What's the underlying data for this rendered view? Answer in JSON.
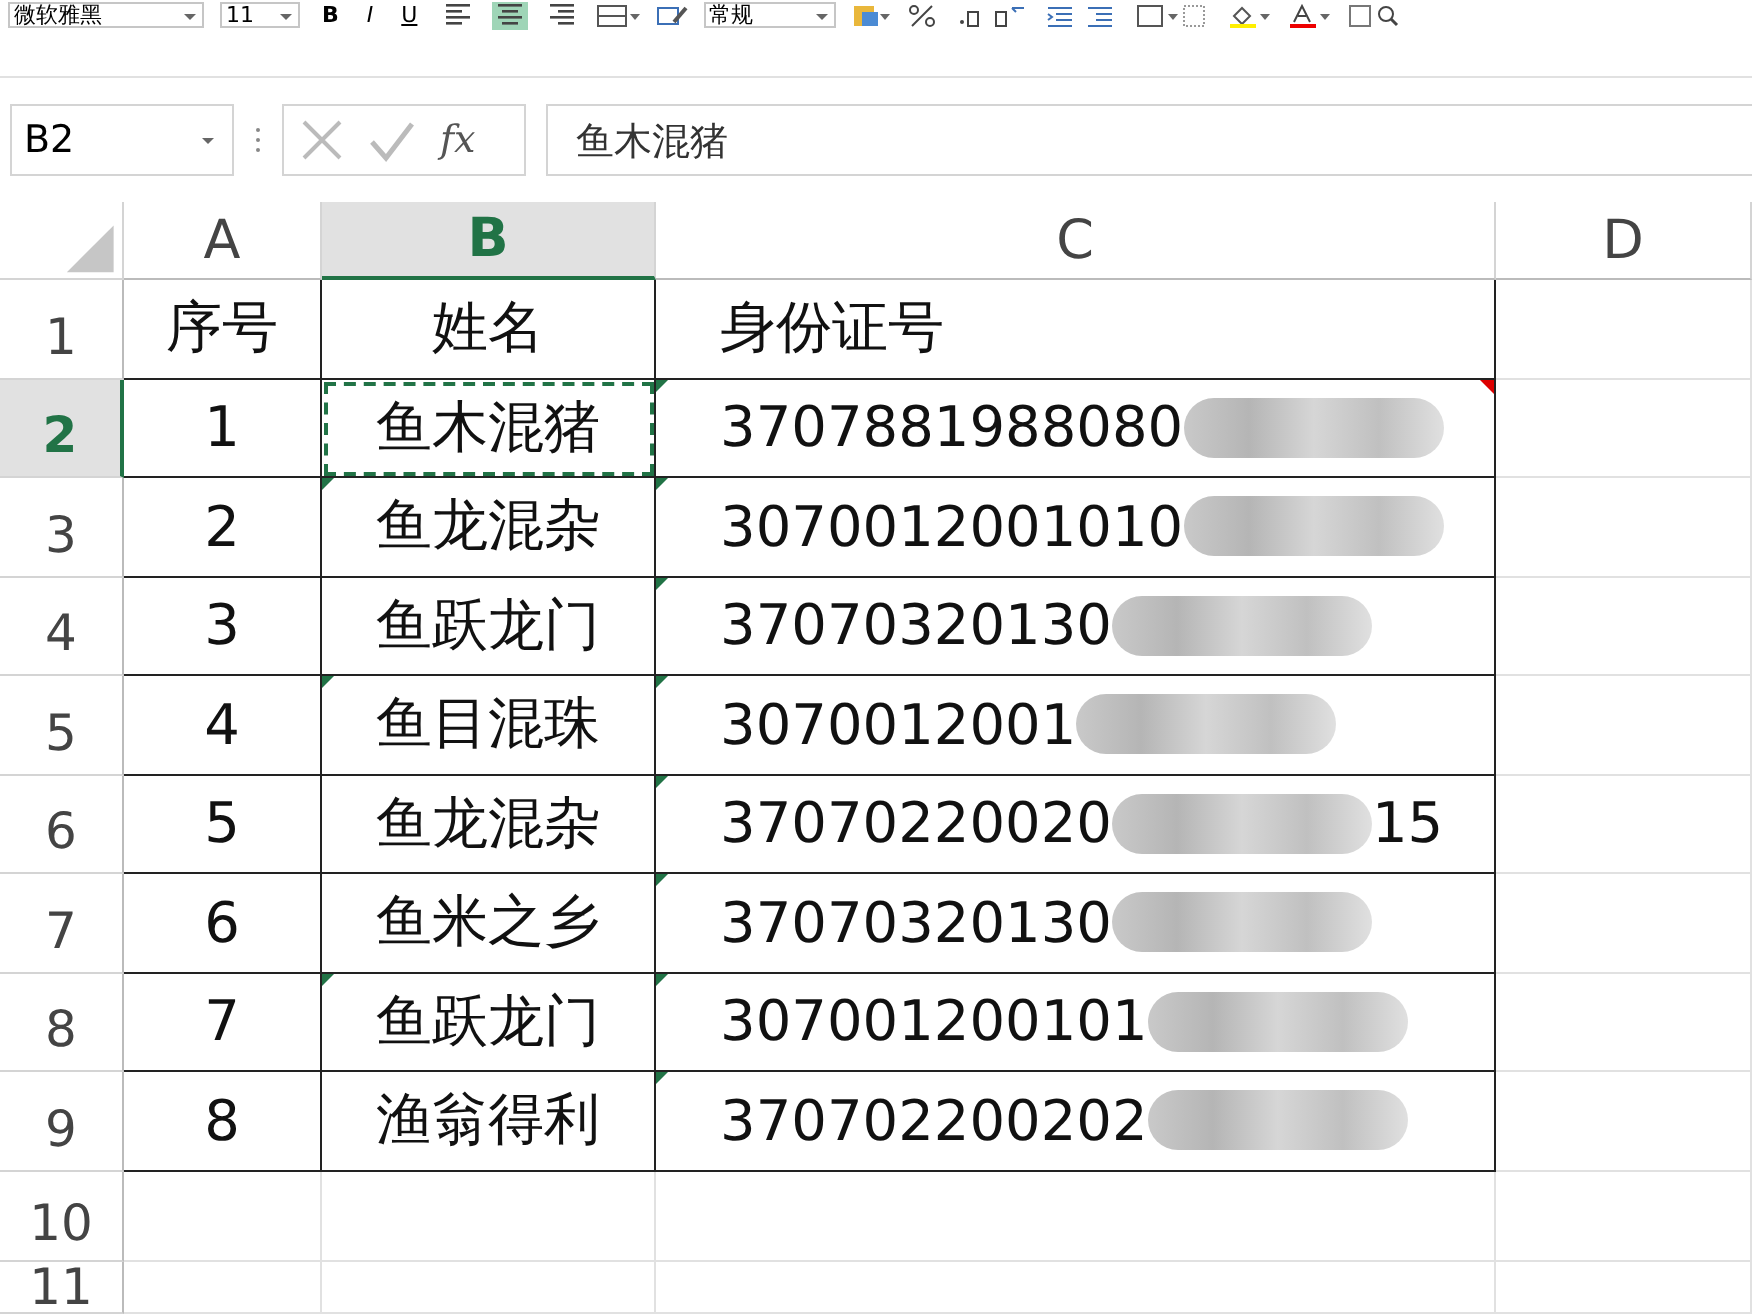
{
  "toolbar": {
    "font": "微软雅黑",
    "size": "11",
    "format": "常规",
    "styles": [
      {
        "label": "B",
        "kind": "bold"
      },
      {
        "label": "I",
        "kind": "italic"
      },
      {
        "label": "U",
        "kind": "underline"
      }
    ],
    "align": [
      {
        "kind": "left",
        "selected": false
      },
      {
        "kind": "center",
        "selected": true
      },
      {
        "kind": "right",
        "selected": false
      }
    ]
  },
  "formula_bar": {
    "name_box": "B2",
    "fx": "fx",
    "value": "鱼木混猪"
  },
  "columns": [
    {
      "label": "A",
      "selected": false
    },
    {
      "label": "B",
      "selected": true
    },
    {
      "label": "C",
      "selected": false
    },
    {
      "label": "D",
      "selected": false
    }
  ],
  "rows": [
    {
      "label": "1",
      "selected": false,
      "cells": [
        {
          "text": "序号",
          "selected": false,
          "flag": false
        },
        {
          "text": "姓名",
          "selected": false,
          "flag": false
        },
        {
          "text": "身份证号",
          "selected": false,
          "flag": false
        }
      ]
    },
    {
      "label": "2",
      "selected": true,
      "cells": [
        {
          "text": "1",
          "selected": false,
          "flag": false
        },
        {
          "text": "鱼木混猪",
          "selected": true,
          "flag": false
        },
        {
          "text": "3707881988080",
          "masked": true,
          "selected": false,
          "flag": true,
          "comment": true
        }
      ]
    },
    {
      "label": "3",
      "selected": false,
      "cells": [
        {
          "text": "2",
          "selected": false,
          "flag": false
        },
        {
          "text": "鱼龙混杂",
          "selected": false,
          "flag": true
        },
        {
          "text": "3070012001010",
          "masked": true,
          "selected": false,
          "flag": true
        }
      ]
    },
    {
      "label": "4",
      "selected": false,
      "cells": [
        {
          "text": "3",
          "selected": false,
          "flag": false
        },
        {
          "text": "鱼跃龙门",
          "selected": false,
          "flag": false
        },
        {
          "text": "37070320130",
          "masked": true,
          "selected": false,
          "flag": true
        }
      ]
    },
    {
      "label": "5",
      "selected": false,
      "cells": [
        {
          "text": "4",
          "selected": false,
          "flag": false
        },
        {
          "text": "鱼目混珠",
          "selected": false,
          "flag": true
        },
        {
          "text": "3070012001",
          "masked": true,
          "selected": false,
          "flag": true
        }
      ]
    },
    {
      "label": "6",
      "selected": false,
      "cells": [
        {
          "text": "5",
          "selected": false,
          "flag": false
        },
        {
          "text": "鱼龙混杂",
          "selected": false,
          "flag": false
        },
        {
          "text": "37070220020",
          "masked": true,
          "tail": "15",
          "selected": false,
          "flag": true
        }
      ]
    },
    {
      "label": "7",
      "selected": false,
      "cells": [
        {
          "text": "6",
          "selected": false,
          "flag": false
        },
        {
          "text": "鱼米之乡",
          "selected": false,
          "flag": false
        },
        {
          "text": "37070320130",
          "masked": true,
          "selected": false,
          "flag": true
        }
      ]
    },
    {
      "label": "8",
      "selected": false,
      "cells": [
        {
          "text": "7",
          "selected": false,
          "flag": false
        },
        {
          "text": "鱼跃龙门",
          "selected": false,
          "flag": true
        },
        {
          "text": "307001200101",
          "masked": true,
          "selected": false,
          "flag": true
        }
      ]
    },
    {
      "label": "9",
      "selected": false,
      "cells": [
        {
          "text": "8",
          "selected": false,
          "flag": false
        },
        {
          "text": "渔翁得利",
          "selected": false,
          "flag": false
        },
        {
          "text": "370702200202",
          "masked": true,
          "selected": false,
          "flag": true
        }
      ]
    },
    {
      "label": "10",
      "selected": false
    },
    {
      "label": "11",
      "selected": false
    }
  ]
}
